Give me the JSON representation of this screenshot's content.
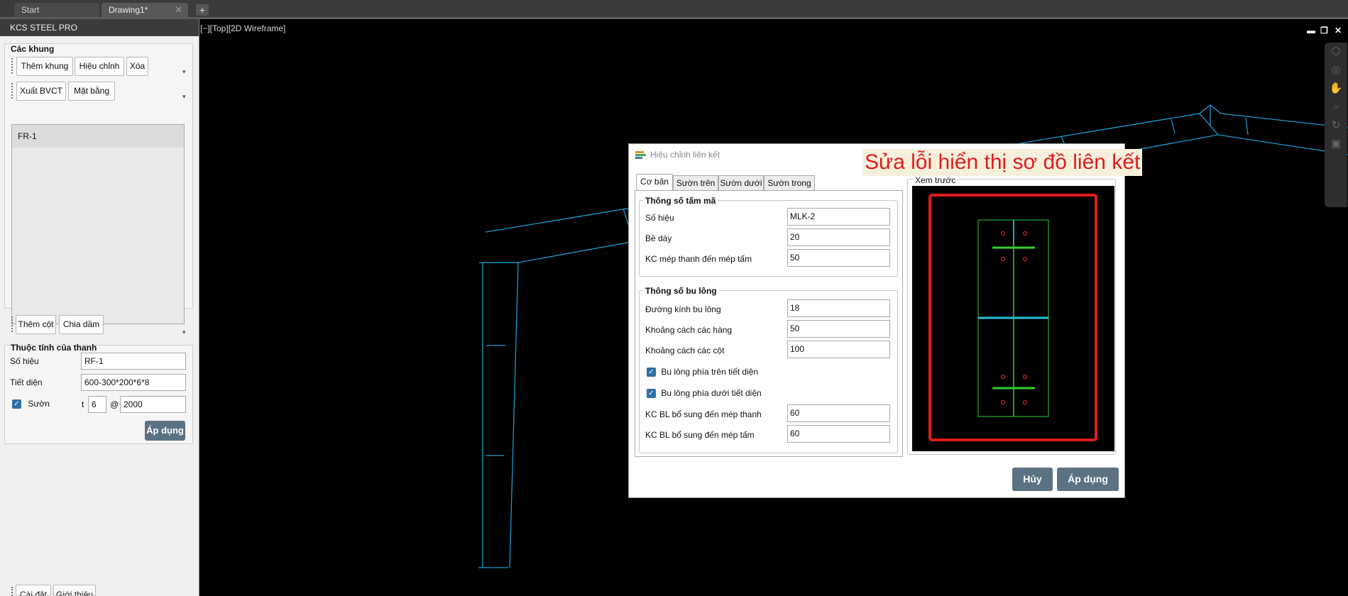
{
  "tabs": {
    "start": "Start",
    "drawing": "Drawing1*",
    "close_glyph": "✕",
    "new_glyph": "+"
  },
  "palette": {
    "title": "KCS STEEL PRO",
    "frames_group": "Các khung",
    "buttons": {
      "add_frame": "Thêm khung",
      "edit": "Hiệu chỉnh",
      "delete": "Xóa",
      "export": "Xuất BVCT",
      "plan": "Mặt bằng",
      "add_column": "Thêm cột",
      "split_beam": "Chia dầm",
      "settings": "Cài đặt",
      "about": "Giới thiệu"
    },
    "frames": [
      "FR-1"
    ],
    "props_group": "Thuộc tính của thanh",
    "props": {
      "id_label": "Số hiệu",
      "id_value": "RF-1",
      "section_label": "Tiết diện",
      "section_value": "600-300*200*6*8",
      "stiffener_label": "Sườn",
      "t_label": "t",
      "t_value": "6",
      "at_label": "@",
      "spacing_value": "2000"
    },
    "apply": "Áp dụng"
  },
  "viewport": {
    "label": "[−][Top][2D Wireframe]",
    "controls": [
      "▬",
      "❐",
      "✕"
    ]
  },
  "dialog": {
    "title": "Hiệu chỉnh liên kết",
    "annotation": "Sửa lỗi hiển thị sơ đồ liên kết",
    "tabs": [
      "Cơ bản",
      "Sườn trên",
      "Sườn dưới",
      "Sườn trong"
    ],
    "plate_group": "Thông số tấm mã",
    "plate": [
      {
        "label": "Số hiệu",
        "value": "MLK-2"
      },
      {
        "label": "Bề dày",
        "value": "20"
      },
      {
        "label": "KC mép thanh đến mép tấm",
        "value": "50"
      }
    ],
    "bolt_group": "Thông số bu lông",
    "bolts": [
      {
        "label": "Đường kính bu lông",
        "value": "18"
      },
      {
        "label": "Khoảng cách các hàng",
        "value": "50"
      },
      {
        "label": "Khoảng cách các cột",
        "value": "100"
      }
    ],
    "bolt_top": "Bu lông phía trên tiết diện",
    "bolt_bottom": "Bu lông phía dưới tiết diện",
    "extra": [
      {
        "label": "KC BL bổ sung đến mép thanh",
        "value": "60"
      },
      {
        "label": "KC BL bổ sung đến mép tấm",
        "value": "60"
      }
    ],
    "preview_label": "Xem trước",
    "cancel": "Hủy",
    "apply": "Áp dụng"
  },
  "colors": {
    "frame": "#1b9ad0",
    "accent_button": "#5b7282",
    "annotation": "#e01c1c"
  }
}
